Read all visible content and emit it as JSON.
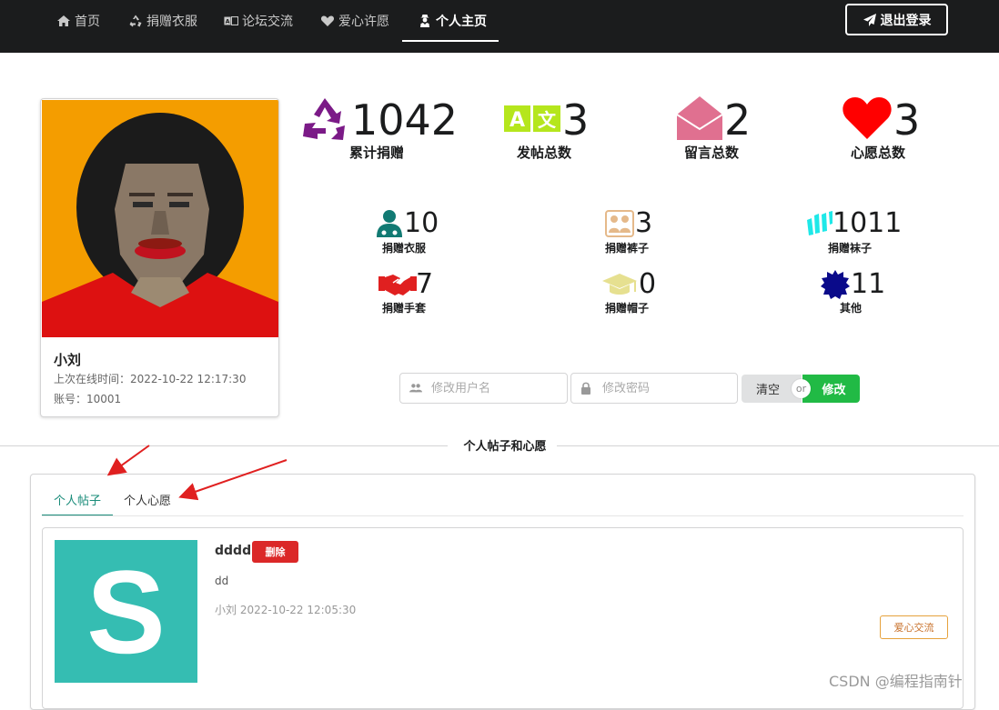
{
  "nav": {
    "items": [
      {
        "label": "首页",
        "icon": "home-icon"
      },
      {
        "label": "捐赠衣服",
        "icon": "recycle-icon"
      },
      {
        "label": "论坛交流",
        "icon": "translate-icon"
      },
      {
        "label": "爱心许愿",
        "icon": "heart-icon"
      },
      {
        "label": "个人主页",
        "icon": "user-secret-icon",
        "active": true
      }
    ],
    "logout_label": "退出登录"
  },
  "profile": {
    "name": "小刘",
    "last_online": "上次在线时间：2022-10-22 12:17:30",
    "account": "账号：10001"
  },
  "stats_main": [
    {
      "value": "1042",
      "label": "累计捐赠",
      "icon": "recycle-icon",
      "color": "#7b1a87"
    },
    {
      "value": "3",
      "label": "发帖总数",
      "icon": "translate-icon",
      "color": "#b5e61d"
    },
    {
      "value": "2",
      "label": "留言总数",
      "icon": "envelope-open-icon",
      "color": "#e07090"
    },
    {
      "value": "3",
      "label": "心愿总数",
      "icon": "heart-icon",
      "color": "#ff0000"
    }
  ],
  "stats_detail": [
    {
      "value": "10",
      "label": "捐赠衣服",
      "icon": "user-md-icon",
      "color": "#117a73"
    },
    {
      "value": "3",
      "label": "捐赠裤子",
      "icon": "users-icon",
      "color": "#e5b98a"
    },
    {
      "value": "1011",
      "label": "捐赠袜子",
      "icon": "wpforms-icon",
      "color": "#1ee8e8"
    },
    {
      "value": "7",
      "label": "捐赠手套",
      "icon": "handshake-icon",
      "color": "#e02020"
    },
    {
      "value": "0",
      "label": "捐赠帽子",
      "icon": "graduation-cap-icon",
      "color": "#e6e090"
    },
    {
      "value": "11",
      "label": "其他",
      "icon": "certificate-icon",
      "color": "#0a0a8a"
    }
  ],
  "form": {
    "username_placeholder": "修改用户名",
    "password_placeholder": "修改密码",
    "clear_label": "清空",
    "or_label": "or",
    "submit_label": "修改"
  },
  "section_title": "个人帖子和心愿",
  "tabs": [
    {
      "label": "个人帖子",
      "active": true
    },
    {
      "label": "个人心愿",
      "active": false
    }
  ],
  "posts": [
    {
      "thumb_letter": "S",
      "title": "dddd",
      "delete_label": "删除",
      "body": "dd",
      "meta": "小刘 2022-10-22 12:05:30",
      "tag": "爱心交流"
    }
  ],
  "watermark": "CSDN @编程指南针"
}
